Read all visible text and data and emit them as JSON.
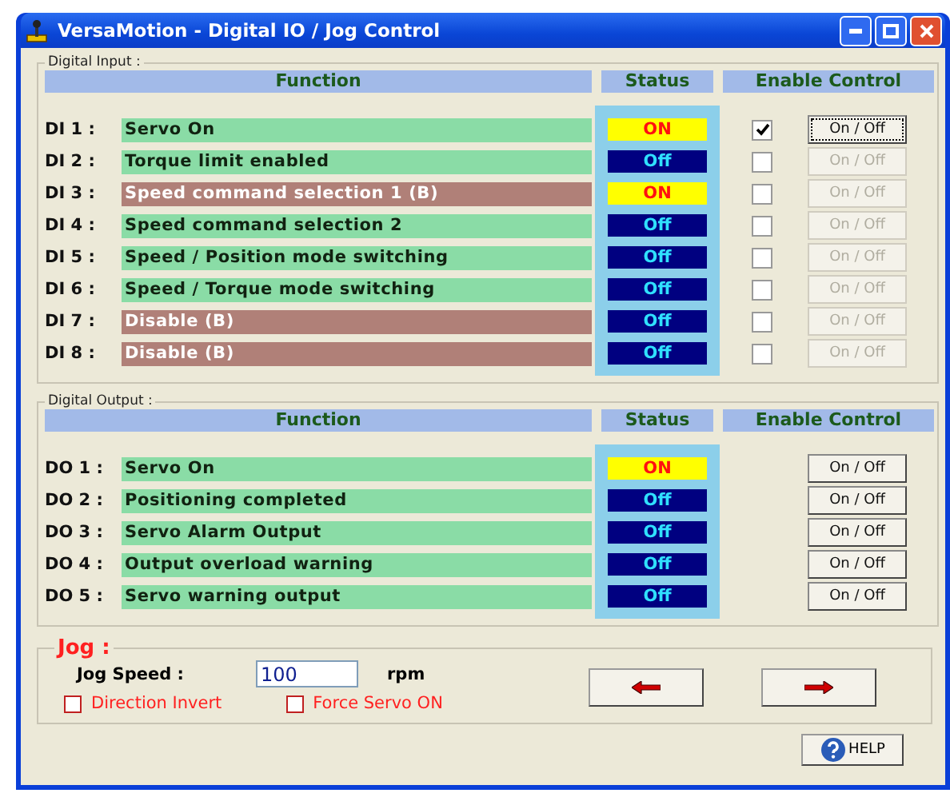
{
  "window": {
    "title": "VersaMotion - Digital IO / Jog Control"
  },
  "digital_input": {
    "title": "Digital Input :",
    "columns": [
      "Function",
      "Status",
      "Enable Control"
    ],
    "rows": [
      {
        "label": "DI 1 :",
        "function": "Servo On",
        "color": "#8adca6",
        "status": "ON",
        "on": true,
        "checked": true,
        "button": "On / Off",
        "disabled": false
      },
      {
        "label": "DI 2 :",
        "function": "Torque limit enabled",
        "color": "#8adca6",
        "status": "Off",
        "on": false,
        "checked": false,
        "button": "On / Off",
        "disabled": true
      },
      {
        "label": "DI 3 :",
        "function": "Speed command selection 1 (B)",
        "color": "#b08078",
        "status": "ON",
        "on": true,
        "checked": false,
        "button": "On / Off",
        "disabled": true
      },
      {
        "label": "DI 4 :",
        "function": "Speed command selection 2",
        "color": "#8adca6",
        "status": "Off",
        "on": false,
        "checked": false,
        "button": "On / Off",
        "disabled": true
      },
      {
        "label": "DI 5 :",
        "function": "Speed / Position mode switching",
        "color": "#8adca6",
        "status": "Off",
        "on": false,
        "checked": false,
        "button": "On / Off",
        "disabled": true
      },
      {
        "label": "DI 6 :",
        "function": "Speed / Torque mode switching",
        "color": "#8adca6",
        "status": "Off",
        "on": false,
        "checked": false,
        "button": "On / Off",
        "disabled": true
      },
      {
        "label": "DI 7 :",
        "function": "Disable (B)",
        "color": "#b08078",
        "status": "Off",
        "on": false,
        "checked": false,
        "button": "On / Off",
        "disabled": true
      },
      {
        "label": "DI 8 :",
        "function": "Disable (B)",
        "color": "#b08078",
        "status": "Off",
        "on": false,
        "checked": false,
        "button": "On / Off",
        "disabled": true
      }
    ]
  },
  "digital_output": {
    "title": "Digital Output :",
    "columns": [
      "Function",
      "Status",
      "Enable Control"
    ],
    "rows": [
      {
        "label": "DO 1 :",
        "function": "Servo On",
        "color": "#8adca6",
        "status": "ON",
        "on": true,
        "button": "On / Off"
      },
      {
        "label": "DO 2 :",
        "function": "Positioning completed",
        "color": "#8adca6",
        "status": "Off",
        "on": false,
        "button": "On / Off"
      },
      {
        "label": "DO 3 :",
        "function": "Servo Alarm Output",
        "color": "#8adca6",
        "status": "Off",
        "on": false,
        "button": "On / Off"
      },
      {
        "label": "DO 4 :",
        "function": "Output overload warning",
        "color": "#8adca6",
        "status": "Off",
        "on": false,
        "button": "On / Off"
      },
      {
        "label": "DO 5 :",
        "function": "Servo warning output",
        "color": "#8adca6",
        "status": "Off",
        "on": false,
        "button": "On / Off"
      }
    ]
  },
  "jog": {
    "title": "Jog :",
    "speed_label": "Jog Speed :",
    "speed_value": "100",
    "unit": "rpm",
    "options": [
      {
        "label": "Direction Invert",
        "checked": false
      },
      {
        "label": "Force Servo ON",
        "checked": false
      }
    ]
  },
  "help_button": "HELP"
}
